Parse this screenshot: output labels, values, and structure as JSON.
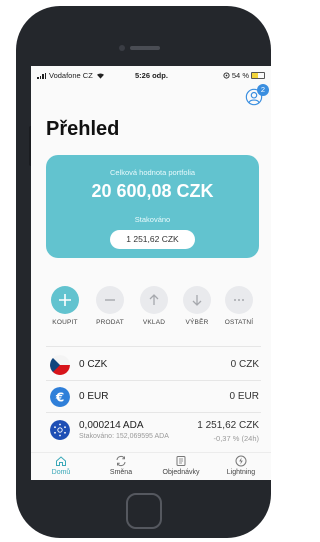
{
  "status_bar": {
    "carrier": "Vodafone CZ",
    "time": "5:26 odp.",
    "battery": "54 %",
    "battery_level": 0.54
  },
  "header": {
    "title": "Přehled",
    "notification_count": "2"
  },
  "portfolio": {
    "label": "Celková hodnota portfolia",
    "value": "20 600,08 CZK",
    "staked_label": "Stakováno",
    "staked_value": "1 251,62 CZK"
  },
  "actions": [
    {
      "label": "KOUPIT",
      "icon": "plus-icon"
    },
    {
      "label": "PRODAT",
      "icon": "minus-icon"
    },
    {
      "label": "VKLAD",
      "icon": "arrow-up-icon"
    },
    {
      "label": "VÝBĚR",
      "icon": "arrow-down-icon"
    },
    {
      "label": "OSTATNÍ",
      "icon": "more-icon"
    }
  ],
  "assets": [
    {
      "name": "0 CZK",
      "value": "0 CZK",
      "icon": "czech-flag-icon"
    },
    {
      "name": "0 EUR",
      "value": "0 EUR",
      "icon": "euro-icon"
    },
    {
      "name": "0,000214 ADA",
      "value": "1 251,62 CZK",
      "sub": "Stakováno: 152,069595 ADA",
      "change": "-0,37 % (24h)",
      "icon": "cardano-icon"
    }
  ],
  "nav": [
    {
      "label": "Domů",
      "icon": "home-icon",
      "active": true
    },
    {
      "label": "Směna",
      "icon": "exchange-icon",
      "active": false
    },
    {
      "label": "Objednávky",
      "icon": "orders-icon",
      "active": false
    },
    {
      "label": "Lightning",
      "icon": "lightning-icon",
      "active": false
    }
  ],
  "colors": {
    "accent": "#62c3cf",
    "nav_active": "#3aa8b8",
    "badge": "#3b8fe0",
    "phone_body": "#24272c"
  }
}
